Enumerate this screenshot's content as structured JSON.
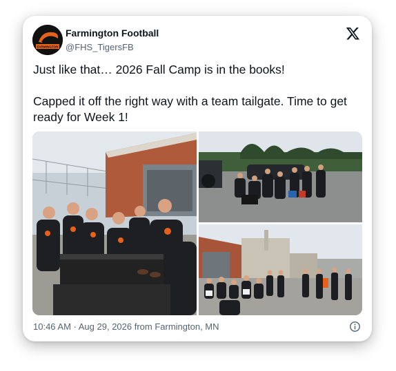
{
  "post": {
    "author_name": "Farmington Football",
    "handle": "@FHS_TigersFB",
    "avatar_text": "FARMINGTON",
    "paragraph_1": "Just like that… 2026 Fall Camp is in the books!",
    "paragraph_2": "Capped it off the right way with a team tailgate. Time to get ready for Week 1!",
    "timestamp": "10:46 AM · Aug 29, 2026 from Farmington, MN"
  },
  "icons": {
    "logo": "x-logo-icon",
    "info": "info-icon"
  },
  "colors": {
    "brand_orange": "#e8611a",
    "text_primary": "#0f1419",
    "text_secondary": "#536471"
  }
}
